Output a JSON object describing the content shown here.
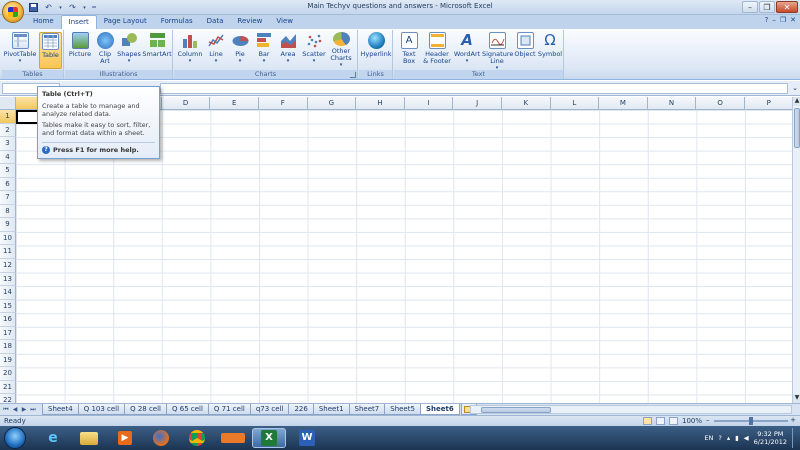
{
  "window": {
    "title": "Main Techyv questions and answers - Microsoft Excel"
  },
  "tabs": [
    "Home",
    "Insert",
    "Page Layout",
    "Formulas",
    "Data",
    "Review",
    "View"
  ],
  "ribbon": {
    "groups": {
      "tables": {
        "label": "Tables",
        "buttons": [
          "PivotTable",
          "Table"
        ]
      },
      "illustrations": {
        "label": "Illustrations",
        "buttons": [
          "Picture",
          "Clip Art",
          "Shapes",
          "SmartArt"
        ]
      },
      "charts": {
        "label": "Charts",
        "buttons": [
          "Column",
          "Line",
          "Pie",
          "Bar",
          "Area",
          "Scatter",
          "Other Charts"
        ]
      },
      "links": {
        "label": "Links",
        "buttons": [
          "Hyperlink"
        ]
      },
      "text": {
        "label": "Text",
        "buttons": [
          "Text Box",
          "Header & Footer",
          "WordArt",
          "Signature Line",
          "Object",
          "Symbol"
        ]
      }
    }
  },
  "tooltip": {
    "title": "Table (Ctrl+T)",
    "line1": "Create a table to manage and analyze related data.",
    "line2": "Tables make it easy to sort, filter, and format data within a sheet.",
    "help": "Press F1 for more help."
  },
  "grid": {
    "columns": [
      "A",
      "B",
      "C",
      "D",
      "E",
      "F",
      "G",
      "H",
      "I",
      "J",
      "K",
      "L",
      "M",
      "N",
      "O",
      "P"
    ],
    "rows": [
      "1",
      "2",
      "3",
      "4",
      "5",
      "6",
      "7",
      "8",
      "9",
      "10",
      "11",
      "12",
      "13",
      "14",
      "15",
      "16",
      "17",
      "18",
      "19",
      "20",
      "21",
      "22"
    ]
  },
  "sheets": {
    "tabs": [
      "Sheet4",
      "Q 103 cell",
      "Q 28 cell",
      "Q 65 cell",
      "Q 71 cell",
      "q73 cell",
      "226",
      "Sheet1",
      "Sheet7",
      "Sheet5",
      "Sheet6"
    ],
    "active": "Sheet6"
  },
  "status": {
    "left": "Ready",
    "zoom": "100%"
  },
  "taskbar": {
    "language": "EN",
    "time": "9:32 PM",
    "date": "6/21/2012"
  },
  "colors": {
    "ribbon_accent": "#15428b",
    "selection": "#f9c454",
    "taskbar": "#1b3452"
  }
}
